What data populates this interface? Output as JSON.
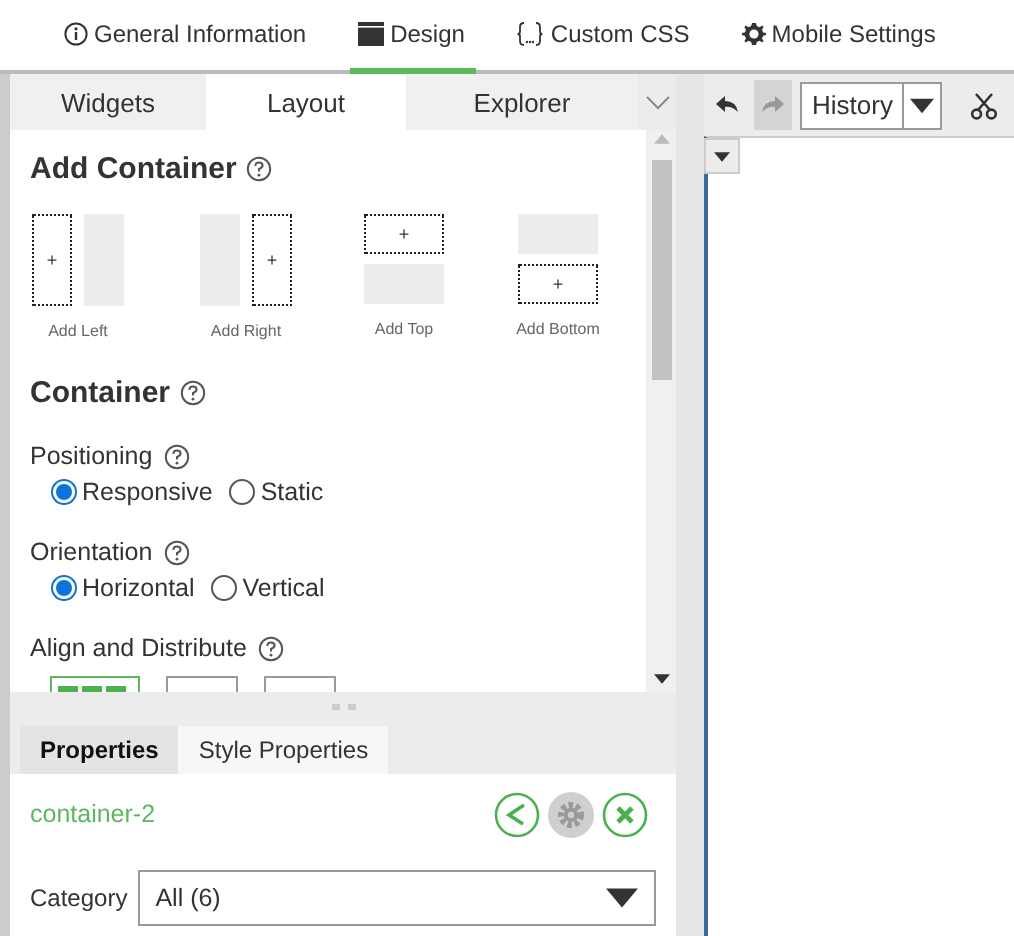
{
  "top_tabs": [
    {
      "label": "General Information",
      "selected": false
    },
    {
      "label": "Design",
      "selected": true
    },
    {
      "label": "Custom CSS",
      "selected": false
    },
    {
      "label": "Mobile Settings",
      "selected": false
    }
  ],
  "panel_tabs": [
    {
      "label": "Widgets",
      "selected": false
    },
    {
      "label": "Layout",
      "selected": true
    },
    {
      "label": "Explorer",
      "selected": false
    }
  ],
  "add_container": {
    "title": "Add Container",
    "options": [
      {
        "label": "Add Left",
        "kind": "left",
        "mark": "+"
      },
      {
        "label": "Add Right",
        "kind": "right",
        "mark": "+"
      },
      {
        "label": "Add Top",
        "kind": "top",
        "mark": "+"
      },
      {
        "label": "Add Bottom",
        "kind": "bottom",
        "mark": "+"
      }
    ]
  },
  "container": {
    "title": "Container"
  },
  "positioning": {
    "label": "Positioning",
    "options": [
      {
        "label": "Responsive",
        "selected": true
      },
      {
        "label": "Static",
        "selected": false
      }
    ]
  },
  "orientation": {
    "label": "Orientation",
    "options": [
      {
        "label": "Horizontal",
        "selected": true
      },
      {
        "label": "Vertical",
        "selected": false
      }
    ]
  },
  "align": {
    "label": "Align and Distribute",
    "options": [
      {
        "selected": true
      },
      {
        "selected": false
      },
      {
        "selected": false
      }
    ]
  },
  "properties_tabs": [
    {
      "label": "Properties",
      "selected": true
    },
    {
      "label": "Style Properties",
      "selected": false
    }
  ],
  "component": {
    "name": "container-2",
    "actions": [
      {
        "kind": "share",
        "disabled": false
      },
      {
        "kind": "gear",
        "disabled": true
      },
      {
        "kind": "close",
        "disabled": false
      }
    ]
  },
  "category": {
    "label": "Category",
    "value": "All (6)"
  },
  "toolbar": {
    "undo": {
      "disabled": false
    },
    "redo": {
      "disabled": true
    },
    "history": "History"
  }
}
